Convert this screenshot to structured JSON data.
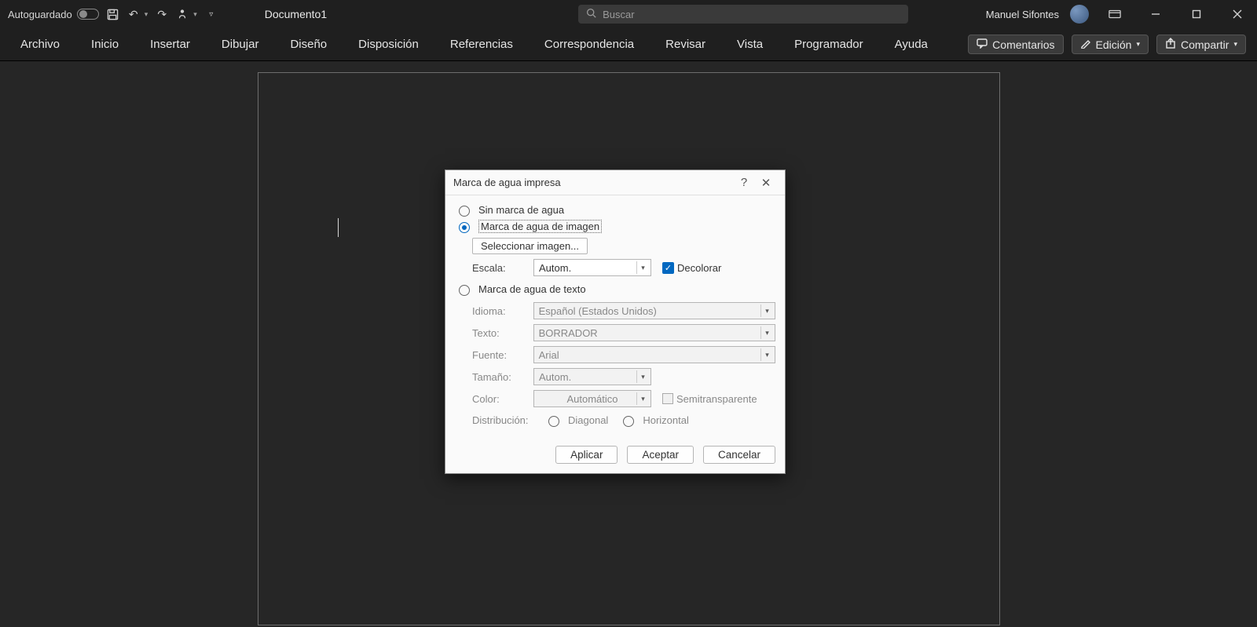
{
  "titlebar": {
    "autosave_label": "Autoguardado",
    "document_title": "Documento1",
    "search_placeholder": "Buscar",
    "user_name": "Manuel Sifontes"
  },
  "ribbon": {
    "tabs": [
      "Archivo",
      "Inicio",
      "Insertar",
      "Dibujar",
      "Diseño",
      "Disposición",
      "Referencias",
      "Correspondencia",
      "Revisar",
      "Vista",
      "Programador",
      "Ayuda"
    ],
    "comments_label": "Comentarios",
    "editing_label": "Edición",
    "share_label": "Compartir"
  },
  "dialog": {
    "title": "Marca de agua impresa",
    "help_symbol": "?",
    "opt_none": "Sin marca de agua",
    "opt_image": "Marca de agua de imagen",
    "opt_text": "Marca de agua de texto",
    "select_image_btn": "Seleccionar imagen...",
    "scale_label": "Escala:",
    "scale_value": "Autom.",
    "washout_label": "Decolorar",
    "language_label": "Idioma:",
    "language_value": "Español (Estados Unidos)",
    "text_label": "Texto:",
    "text_value": "BORRADOR",
    "font_label": "Fuente:",
    "font_value": "Arial",
    "size_label": "Tamaño:",
    "size_value": "Autom.",
    "color_label": "Color:",
    "color_value": "Automático",
    "semitransparent_label": "Semitransparente",
    "layout_label": "Distribución:",
    "layout_diagonal": "Diagonal",
    "layout_horizontal": "Horizontal",
    "btn_apply": "Aplicar",
    "btn_ok": "Aceptar",
    "btn_cancel": "Cancelar"
  }
}
